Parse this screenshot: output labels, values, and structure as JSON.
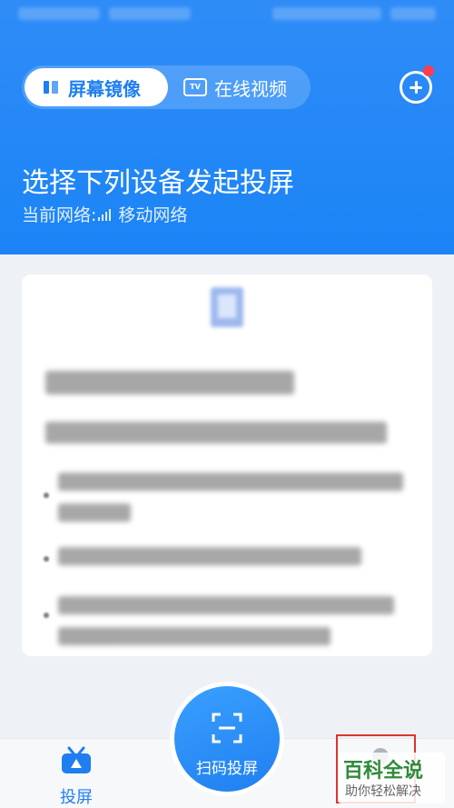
{
  "colors": {
    "primary": "#1f7ff0",
    "header_bg": "#2f8cf7",
    "badge": "#ff3b4e",
    "highlight": "#e0332c"
  },
  "header": {
    "mode_tabs": [
      {
        "label": "屏幕镜像",
        "icon": "mirror-icon",
        "active": true
      },
      {
        "label": "在线视频",
        "icon": "tv-icon",
        "active": false
      }
    ],
    "tv_icon_text": "TV",
    "add_icon": "plus-circle-icon",
    "title": "选择下列设备发起投屏",
    "network_label": "当前网络:",
    "network_name": "移动网络"
  },
  "bottom_nav": {
    "cast_label": "投屏",
    "scan_label": "扫码投屏"
  },
  "watermark": {
    "title": "百科全说",
    "subtitle": "助你轻松解决"
  }
}
